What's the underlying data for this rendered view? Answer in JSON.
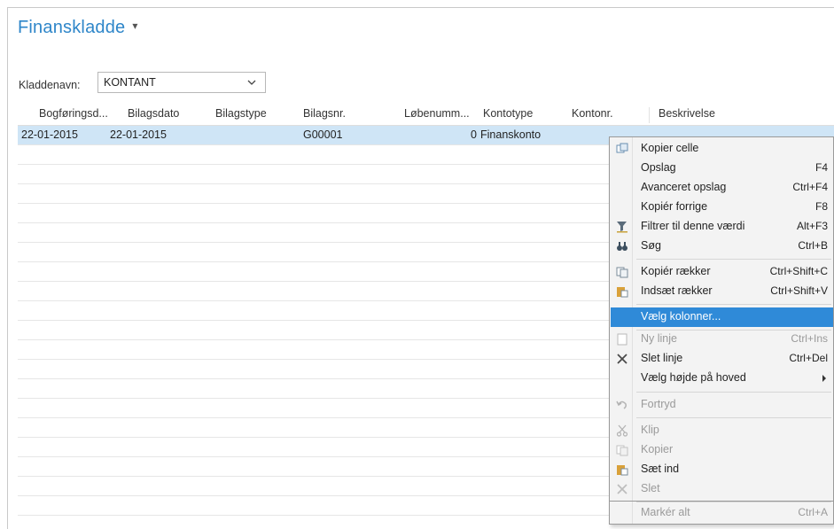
{
  "page": {
    "title": "Finanskladde",
    "title_caret": "▾"
  },
  "batch": {
    "label": "Kladdenavn:",
    "value": "KONTANT"
  },
  "grid": {
    "columns": [
      "Bogføringsd...",
      "Bilagsdato",
      "Bilagstype",
      "Bilagsnr.",
      "Løbenumm...",
      "Kontotype",
      "Kontonr.",
      "Beskrivelse"
    ],
    "rows": [
      {
        "posting_date": "22-01-2015",
        "document_date": "22-01-2015",
        "document_type": "",
        "document_no": "G00001",
        "entry_no": "0",
        "account_type": "Finanskonto",
        "account_no": "",
        "description": ""
      }
    ]
  },
  "context_menu": {
    "items": [
      {
        "label": "Kopier celle",
        "shortcut": "",
        "icon": "copy-cell-icon",
        "disabled": false
      },
      {
        "label": "Opslag",
        "shortcut": "F4",
        "icon": "",
        "disabled": false
      },
      {
        "label": "Avanceret opslag",
        "shortcut": "Ctrl+F4",
        "icon": "",
        "disabled": false
      },
      {
        "label": "Kopiér forrige",
        "shortcut": "F8",
        "icon": "",
        "disabled": false
      },
      {
        "label": "Filtrer til denne værdi",
        "shortcut": "Alt+F3",
        "icon": "filter-icon",
        "disabled": false
      },
      {
        "label": "Søg",
        "shortcut": "Ctrl+B",
        "icon": "binoculars-icon",
        "disabled": false
      },
      {
        "label": "Kopiér rækker",
        "shortcut": "Ctrl+Shift+C",
        "icon": "copy-rows-icon",
        "disabled": false
      },
      {
        "label": "Indsæt rækker",
        "shortcut": "Ctrl+Shift+V",
        "icon": "paste-rows-icon",
        "disabled": false
      },
      {
        "label": "Vælg kolonner...",
        "shortcut": "",
        "icon": "",
        "disabled": false,
        "highlighted": true
      },
      {
        "label": "Ny linje",
        "shortcut": "Ctrl+Ins",
        "icon": "new-line-icon",
        "disabled": true
      },
      {
        "label": "Slet linje",
        "shortcut": "Ctrl+Del",
        "icon": "delete-line-icon",
        "disabled": false
      },
      {
        "label": "Vælg højde på hoved",
        "shortcut": "",
        "icon": "",
        "disabled": false,
        "submenu": true
      },
      {
        "label": "Fortryd",
        "shortcut": "",
        "icon": "undo-icon",
        "disabled": true
      },
      {
        "label": "Klip",
        "shortcut": "",
        "icon": "cut-icon",
        "disabled": true
      },
      {
        "label": "Kopier",
        "shortcut": "",
        "icon": "copy-icon",
        "disabled": true
      },
      {
        "label": "Sæt ind",
        "shortcut": "",
        "icon": "paste-icon",
        "disabled": false
      },
      {
        "label": "Slet",
        "shortcut": "",
        "icon": "delete-icon",
        "disabled": true
      },
      {
        "label": "Markér alt",
        "shortcut": "Ctrl+A",
        "icon": "",
        "disabled": true
      }
    ]
  },
  "colors": {
    "title": "#2e86c9",
    "selected_row": "#cfe5f6",
    "menu_highlight": "#2f8ad8"
  }
}
